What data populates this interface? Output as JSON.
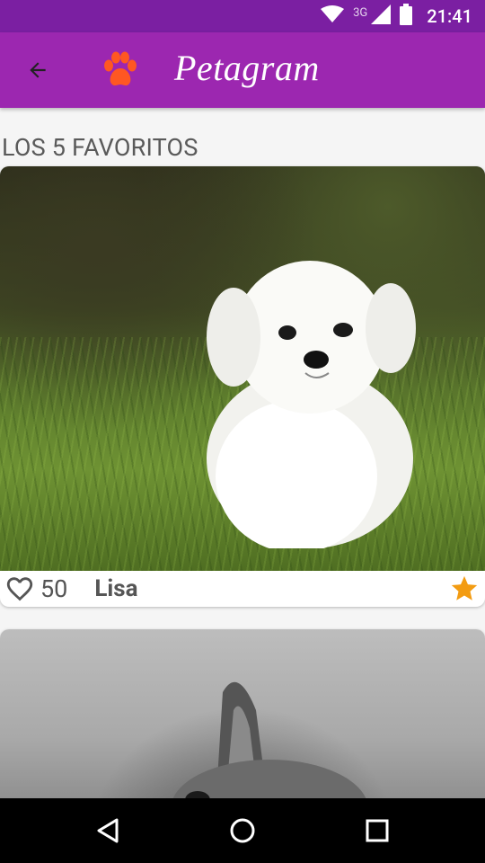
{
  "status_bar": {
    "network": "3G",
    "time": "21:41"
  },
  "app_bar": {
    "title": "Petagram",
    "accent": "#9c27b0",
    "status_color": "#7b1fa2",
    "paw_color": "#ff5722"
  },
  "section": {
    "title": "LOS 5 FAVORITOS"
  },
  "pets": [
    {
      "likes": "50",
      "name": "Lisa",
      "favorite": true,
      "photo": "white-puppy-in-grass"
    },
    {
      "photo": "gray-dog-ear"
    }
  ],
  "icons": {
    "back": "arrow-left-icon",
    "paw": "paw-icon",
    "heart": "heart-outline-icon",
    "star": "star-icon"
  },
  "colors": {
    "star": "#f39c12",
    "text": "#555555"
  }
}
